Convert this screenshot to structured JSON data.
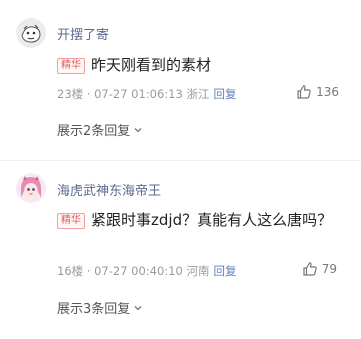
{
  "comments": [
    {
      "username": "开摆了寄",
      "badge": "精华",
      "text": "昨天刚看到的素材",
      "meta": "23楼 · 07-27 01:06:13 浙江",
      "reply_label": "回复",
      "likes": "136",
      "expand_label": "展示2条回复",
      "avatar_icon": "sketch-avatar-icon"
    },
    {
      "username": "海虎武神东海帝王",
      "badge": "精华",
      "text": "紧跟时事zdjd？真能有人这么唐吗？",
      "meta": "16楼 · 07-27 00:40:10 河南",
      "reply_label": "回复",
      "likes": "79",
      "expand_label": "展示3条回复",
      "avatar_icon": "anime-girl-avatar-icon"
    }
  ],
  "colors": {
    "username": "#5b6b8c",
    "badge": "#e45a5a",
    "reply_link": "#5b7fc0"
  }
}
